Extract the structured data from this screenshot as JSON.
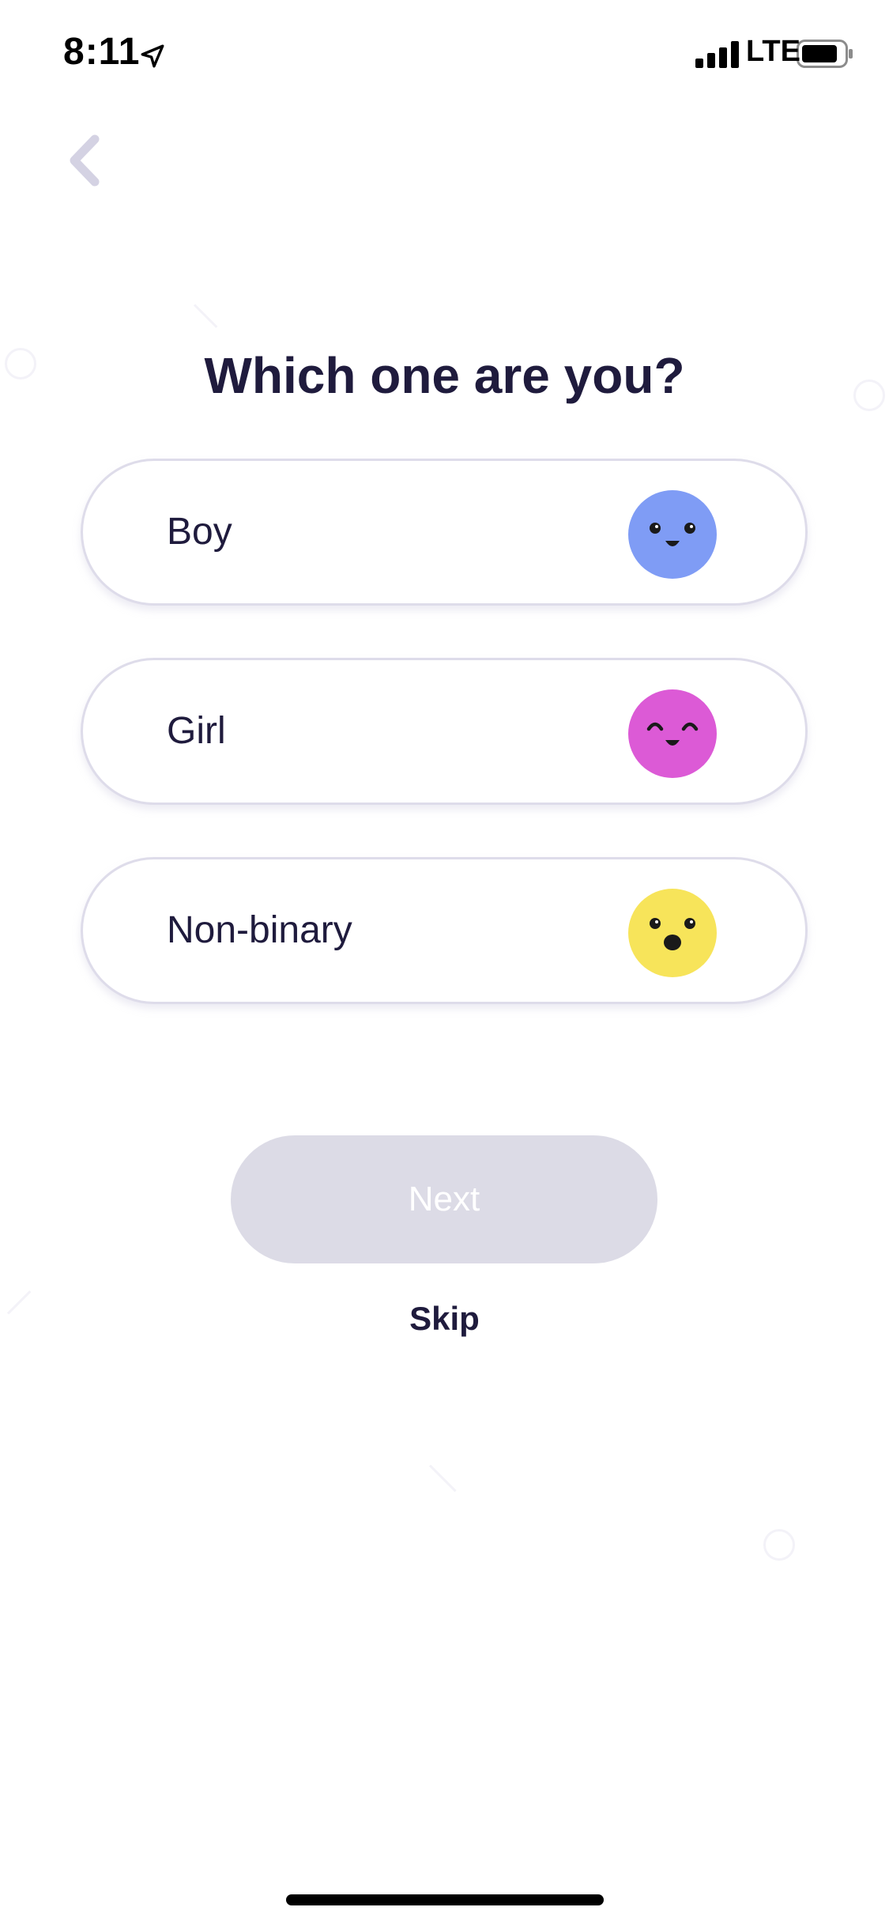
{
  "status_bar": {
    "time": "8:11",
    "network": "LTE",
    "icons": [
      "location-arrow-icon",
      "signal-bars-icon",
      "battery-icon"
    ]
  },
  "navigation": {
    "back_icon": "chevron-left-icon"
  },
  "title": "Which one are you?",
  "options": [
    {
      "label": "Boy",
      "icon": "smiley-face-icon",
      "color": "#7f9cf5"
    },
    {
      "label": "Girl",
      "icon": "smiling-closed-eyes-face-icon",
      "color": "#dc5ad6"
    },
    {
      "label": "Non-binary",
      "icon": "surprised-face-icon",
      "color": "#f7e45a"
    }
  ],
  "actions": {
    "next_label": "Next",
    "skip_label": "Skip"
  },
  "colors": {
    "text_primary": "#1f1b3d",
    "disabled_button": "#dcdbe6",
    "option_border": "#dedcea",
    "back_icon": "#d4d2e3"
  }
}
